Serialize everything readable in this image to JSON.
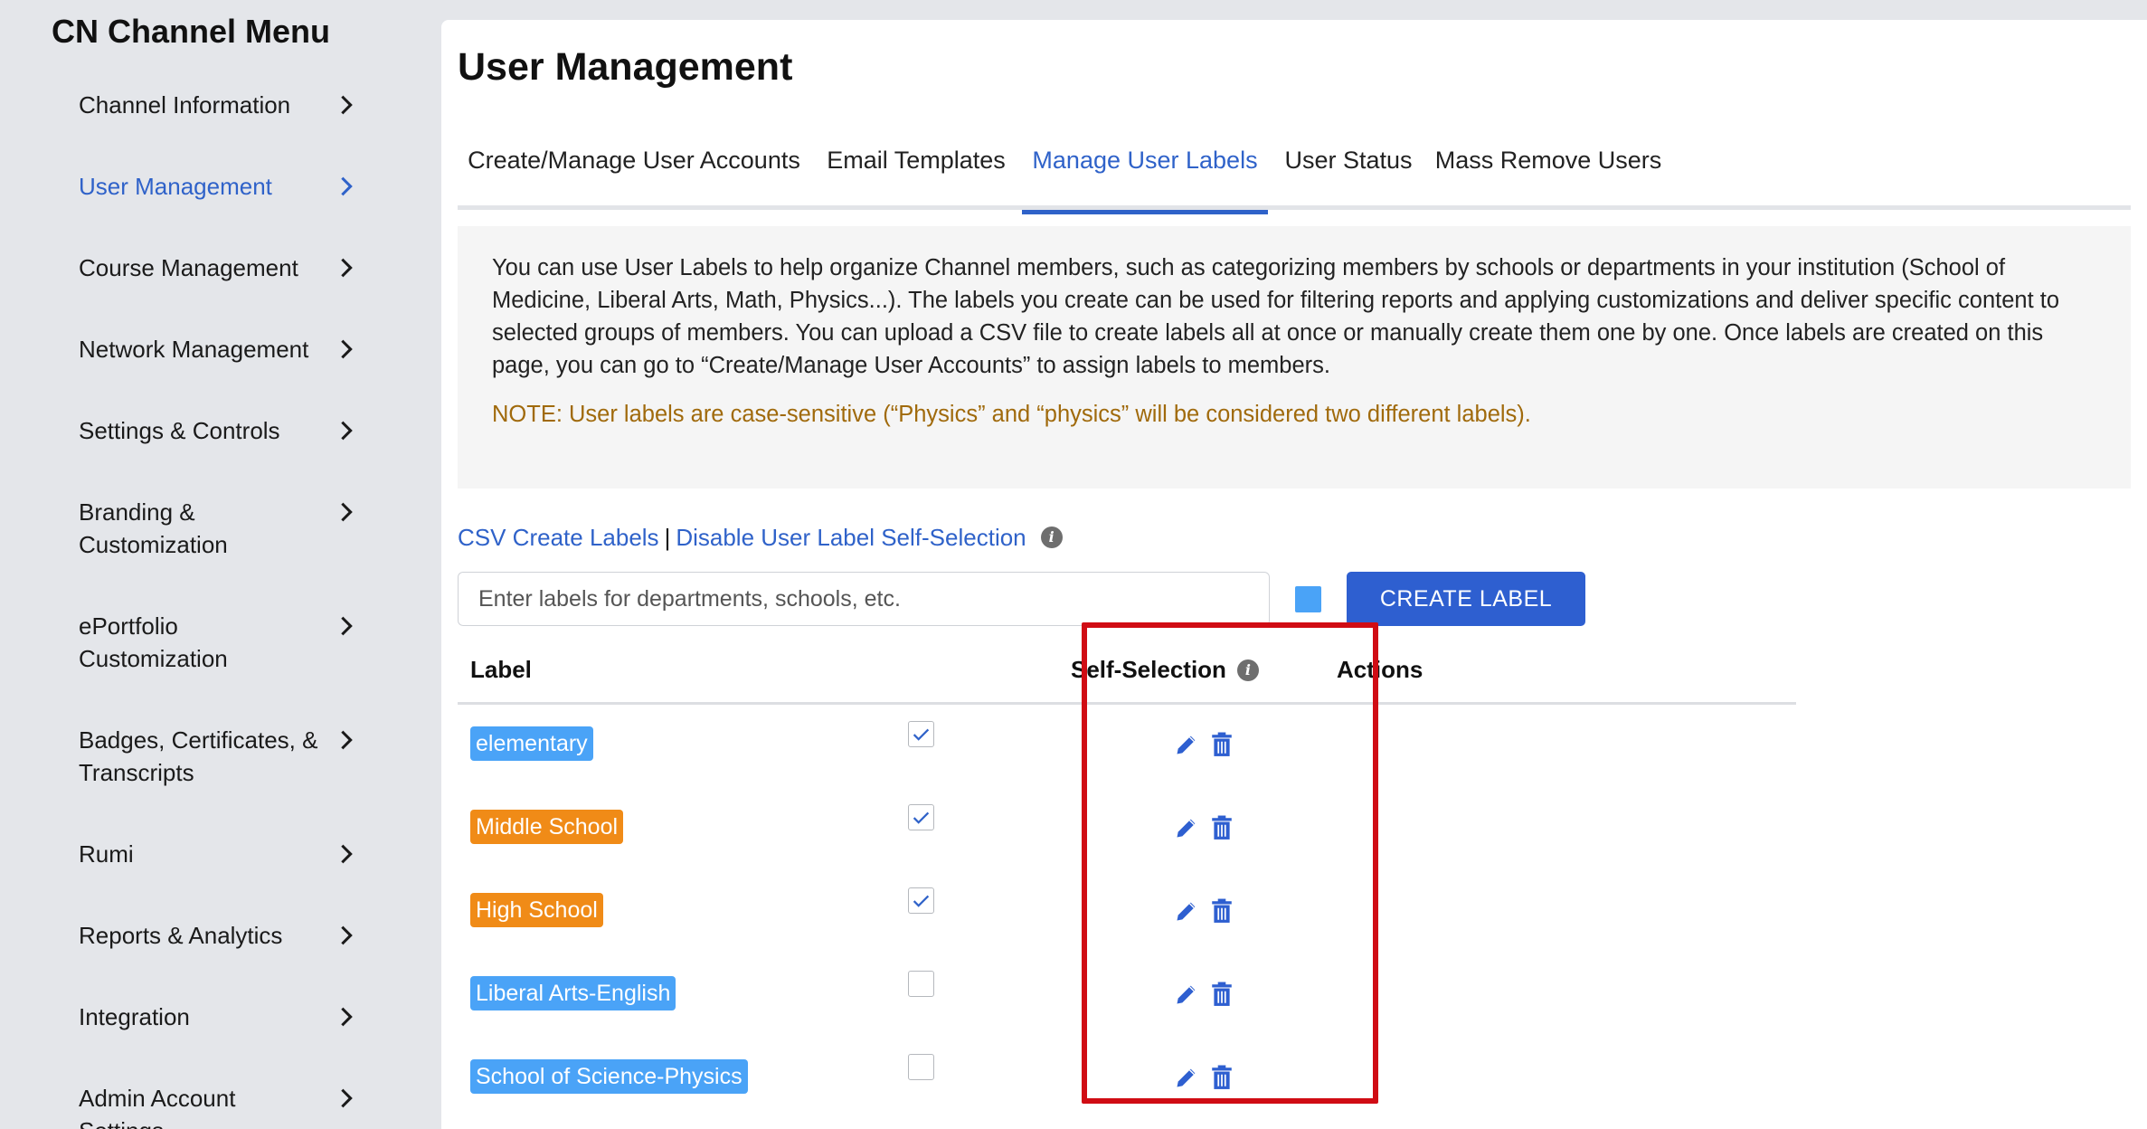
{
  "sidebar": {
    "title": "CN Channel Menu",
    "items": [
      {
        "label": "Channel Information",
        "active": false
      },
      {
        "label": "User Management",
        "active": true
      },
      {
        "label": "Course Management",
        "active": false
      },
      {
        "label": "Network Management",
        "active": false
      },
      {
        "label": "Settings & Controls",
        "active": false
      },
      {
        "label": "Branding & Customization",
        "active": false
      },
      {
        "label": "ePortfolio Customization",
        "active": false
      },
      {
        "label": "Badges, Certificates, & Transcripts",
        "active": false
      },
      {
        "label": "Rumi",
        "active": false
      },
      {
        "label": "Reports & Analytics",
        "active": false
      },
      {
        "label": "Integration",
        "active": false
      },
      {
        "label": "Admin Account Settings",
        "active": false
      }
    ]
  },
  "main": {
    "title": "User Management",
    "tabs": [
      {
        "label": "Create/Manage User Accounts",
        "active": false
      },
      {
        "label": "Email Templates",
        "active": false
      },
      {
        "label": "Manage User Labels",
        "active": true
      },
      {
        "label": "User Status",
        "active": false
      },
      {
        "label": "Mass Remove Users",
        "active": false
      }
    ],
    "info": {
      "text": "You can use User Labels to help organize Channel members, such as categorizing members by schools or departments in your institution (School of Medicine, Liberal Arts, Math, Physics...). The labels you create can be used for filtering reports and applying customizations and deliver specific content to selected groups of members. You can upload a CSV file to create labels all at once or manually create them one by one. Once labels are created on this page, you can go to “Create/Manage User Accounts” to assign labels to members.",
      "note": "NOTE: User labels are case-sensitive (“Physics” and “physics” will be considered two different labels)."
    },
    "links": {
      "csv_create": "CSV Create Labels",
      "separator": "|",
      "disable_self_selection": "Disable User Label Self-Selection"
    },
    "input": {
      "placeholder": "Enter labels for departments, schools, etc.",
      "value": ""
    },
    "swatch_color": "#4aa3f7",
    "create_button": "CREATE LABEL",
    "table": {
      "headers": {
        "label": "Label",
        "self_selection": "Self-Selection",
        "actions": "Actions"
      },
      "rows": [
        {
          "label": "elementary",
          "color": "blue",
          "self_selection": true
        },
        {
          "label": "Middle School",
          "color": "orange",
          "self_selection": true
        },
        {
          "label": "High School",
          "color": "orange",
          "self_selection": true
        },
        {
          "label": "Liberal Arts-English",
          "color": "blue",
          "self_selection": false
        },
        {
          "label": "School of Science-Physics",
          "color": "blue",
          "self_selection": false
        }
      ]
    }
  },
  "colors": {
    "accent": "#2f62c9",
    "button": "#2e5fd0",
    "tag_blue": "#4aa3f7",
    "tag_orange": "#f08b17",
    "note": "#a06a0c",
    "highlight": "#d00c14"
  }
}
